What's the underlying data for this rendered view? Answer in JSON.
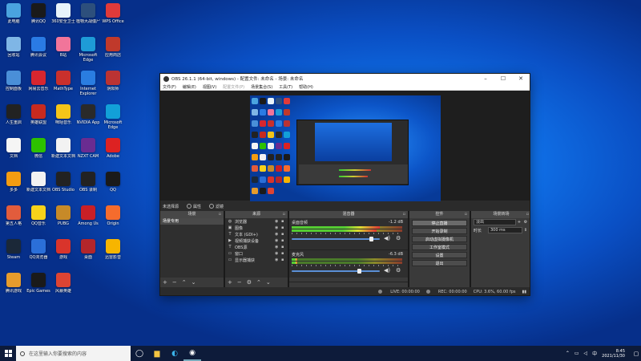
{
  "desktop": {
    "icons": [
      {
        "label": "此电脑",
        "color": "#4aa3df"
      },
      {
        "label": "腾讯QQ",
        "color": "#1a1a1a"
      },
      {
        "label": "360安全卫士",
        "color": "#e8f4fb"
      },
      {
        "label": "植物大战僵尸",
        "color": "#2d4f7c"
      },
      {
        "label": "WPS Office",
        "color": "#e03a3a"
      },
      {
        "label": "回收站",
        "color": "#7fb6e6"
      },
      {
        "label": "腾讯会议",
        "color": "#2a7be4"
      },
      {
        "label": "B站",
        "color": "#f1759a"
      },
      {
        "label": "Microsoft Edge",
        "color": "#1e9bd7"
      },
      {
        "label": "应用商店",
        "color": "#c0392b"
      },
      {
        "label": "控制面板",
        "color": "#4a8fd8"
      },
      {
        "label": "网易云音乐",
        "color": "#d7262f"
      },
      {
        "label": "MathType",
        "color": "#c9302c"
      },
      {
        "label": "Internet Explorer",
        "color": "#2a7de1"
      },
      {
        "label": "阴阳师",
        "color": "#b33"
      },
      {
        "label": "人生重启",
        "color": "#222"
      },
      {
        "label": "英雄联盟",
        "color": "#c72a1f"
      },
      {
        "label": "咪咕音乐",
        "color": "#f5c518"
      },
      {
        "label": "NVIDIA App",
        "color": "#2a2a2a"
      },
      {
        "label": "Microsoft Edge",
        "color": "#12a0d8"
      },
      {
        "label": "文档",
        "color": "#f5f5f5"
      },
      {
        "label": "微信",
        "color": "#2dc100"
      },
      {
        "label": "新建文本文档",
        "color": "#f2f2f2"
      },
      {
        "label": "NZXT CAM",
        "color": "#6a2c91"
      },
      {
        "label": "Adobe",
        "color": "#d22"
      },
      {
        "label": "多多",
        "color": "#f39c12"
      },
      {
        "label": "新建文本文档",
        "color": "#f2f2f2"
      },
      {
        "label": "OBS Studio",
        "color": "#222"
      },
      {
        "label": "OBS 录制",
        "color": "#222"
      },
      {
        "label": "QQ",
        "color": "#1a1a1a"
      },
      {
        "label": "第五人格",
        "color": "#e25c3c"
      },
      {
        "label": "QQ音乐",
        "color": "#f7d21a"
      },
      {
        "label": "PUBG",
        "color": "#c78a28"
      },
      {
        "label": "Among Us",
        "color": "#c91f26"
      },
      {
        "label": "Origin",
        "color": "#f56c2d"
      },
      {
        "label": "Steam",
        "color": "#1b2838"
      },
      {
        "label": "QQ浏览器",
        "color": "#2b6fd8"
      },
      {
        "label": "游戏",
        "color": "#d9342b"
      },
      {
        "label": "桌面",
        "color": "#b3262b"
      },
      {
        "label": "迅雷影音",
        "color": "#f7b500"
      },
      {
        "label": "腾讯游戏",
        "color": "#e69b2c"
      },
      {
        "label": "Epic Games",
        "color": "#1a1a1a"
      },
      {
        "label": "风暴英雄",
        "color": "#d43"
      }
    ]
  },
  "obs": {
    "title": "OBS 26.1.1 (64-bit, windows) - 配置文件: 未命名 - 场景: 未命名",
    "menu": [
      "文件(F)",
      "编辑(E)",
      "视图(V)",
      "配置文件(P)",
      "场景集合(S)",
      "工具(T)",
      "帮助(H)"
    ],
    "no_source_selected": "未选择源",
    "properties_label": "属性",
    "filters_label": "滤镜",
    "docks": {
      "scenes": {
        "title": "场景",
        "items": [
          "场景专用"
        ]
      },
      "sources": {
        "title": "来源",
        "items": [
          {
            "icon": "browser-icon",
            "glyph": "◍",
            "name": "浏览器"
          },
          {
            "icon": "image-icon",
            "glyph": "▣",
            "name": "图像"
          },
          {
            "icon": "text-icon",
            "glyph": "T",
            "name": "文本 (GDI+)"
          },
          {
            "icon": "video-capture-icon",
            "glyph": "▶",
            "name": "视频捕获设备"
          },
          {
            "icon": "text-icon",
            "glyph": "T",
            "name": "OBS源"
          },
          {
            "icon": "window-icon",
            "glyph": "▭",
            "name": "窗口"
          },
          {
            "icon": "monitor-icon",
            "glyph": "▭",
            "name": "显示器捕获"
          }
        ]
      },
      "mixer": {
        "title": "混音器",
        "channels": [
          {
            "name": "桌面音频",
            "db": "-1.2 dB",
            "level": 0.8,
            "fader": 0.92
          },
          {
            "name": "麦克风",
            "db": "-6.3 dB",
            "level": 0.05,
            "fader": 0.78
          }
        ]
      },
      "controls": {
        "title": "控件",
        "buttons": [
          "停止直播",
          "开始录制",
          "启动虚拟摄像机",
          "工作室模式",
          "设置",
          "退出"
        ]
      },
      "transitions": {
        "title": "场景转场",
        "type": "淡出",
        "duration_label": "时长",
        "duration_value": "300 ms"
      }
    },
    "status": {
      "live": "LIVE: 00:00:00",
      "rec": "REC: 00:00:00",
      "cpu": "CPU: 3.6%, 60.00 fps"
    }
  },
  "taskbar": {
    "search_placeholder": "在这里输入你要搜索的内容",
    "time": "8:45",
    "date": "2021/11/30"
  }
}
